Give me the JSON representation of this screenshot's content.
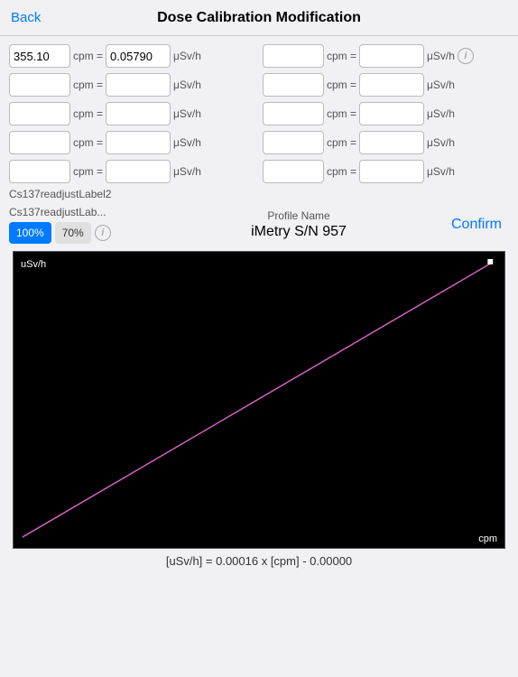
{
  "header": {
    "back_label": "Back",
    "title": "Dose Calibration Modification"
  },
  "rows": [
    [
      {
        "cpm_value": "355.10",
        "usv_value": "0.05790"
      },
      {
        "cpm_value": "",
        "usv_value": ""
      }
    ],
    [
      {
        "cpm_value": "",
        "usv_value": ""
      },
      {
        "cpm_value": "",
        "usv_value": ""
      }
    ],
    [
      {
        "cpm_value": "",
        "usv_value": ""
      },
      {
        "cpm_value": "",
        "usv_value": ""
      }
    ],
    [
      {
        "cpm_value": "",
        "usv_value": ""
      },
      {
        "cpm_value": "",
        "usv_value": ""
      }
    ],
    [
      {
        "cpm_value": "",
        "usv_value": ""
      },
      {
        "cpm_value": "",
        "usv_value": ""
      }
    ]
  ],
  "labels": {
    "cpm_eq": "cpm =",
    "usv_unit": "μSv/h",
    "info_icon": "i",
    "readjust_label1": "Cs137readjustLabel2",
    "readjust_label2": "Cs137readjustLab...",
    "profile_name_label": "Profile Name",
    "profile_name_value": "iMetry S/N 957",
    "confirm": "Confirm",
    "toggle_100": "100%",
    "toggle_70": "70%",
    "chart_y": "uSv/h",
    "chart_x": "cpm",
    "formula": "[uSv/h] = 0.00016 x [cpm] - 0.00000"
  }
}
